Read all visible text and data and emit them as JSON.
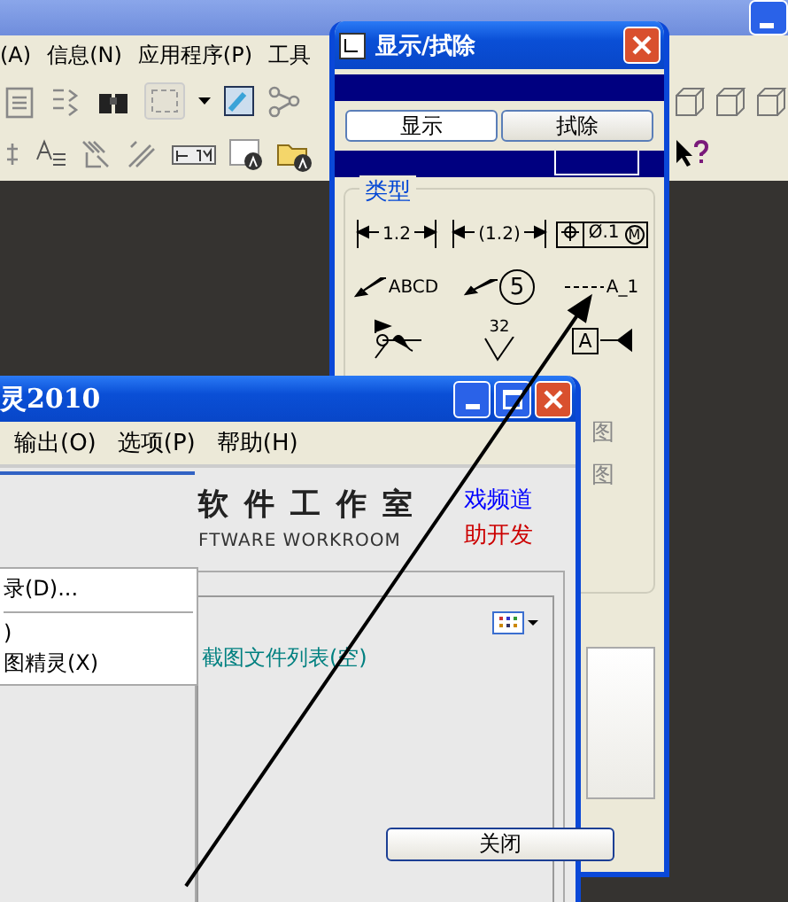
{
  "app": {
    "menu": [
      "(A)",
      "信息(N)",
      "应用程序(P)",
      "工具"
    ]
  },
  "dialog": {
    "title": "显示/拭除",
    "tabs": [
      {
        "label": "显示",
        "selected": true
      },
      {
        "label": "拭除",
        "selected": false
      }
    ],
    "group_title": "类型",
    "symbols": [
      {
        "kind": "dimension",
        "text": "1.2"
      },
      {
        "kind": "ref-dimension",
        "text": "(1.2)"
      },
      {
        "kind": "gtol",
        "text": "Ø.1",
        "modifier": "M"
      },
      {
        "kind": "note",
        "text": "ABCD"
      },
      {
        "kind": "balloon",
        "text": "5"
      },
      {
        "kind": "axis",
        "text": "A_1"
      },
      {
        "kind": "weld"
      },
      {
        "kind": "surface-finish",
        "text": "32"
      },
      {
        "kind": "datum",
        "text": "A"
      }
    ],
    "side_labels": [
      "图",
      "图"
    ],
    "close_button": "关闭"
  },
  "helper": {
    "title": "灵2010",
    "menu": [
      "输出(O)",
      "选项(P)",
      "帮助(H)"
    ],
    "dropdown": [
      {
        "kind": "item",
        "label": "录(D)..."
      },
      {
        "kind": "separator"
      },
      {
        "kind": "item",
        "label": ")"
      },
      {
        "kind": "item",
        "label": "图精灵(X)"
      }
    ],
    "banner_title": "软件工作室",
    "banner_subtitle": "FTWARE WORKROOM",
    "links": [
      {
        "label": "戏频道",
        "color": "#0000ff"
      },
      {
        "label": "助开发",
        "color": "#cc0000"
      }
    ],
    "file_list": "截图文件列表(空)"
  }
}
